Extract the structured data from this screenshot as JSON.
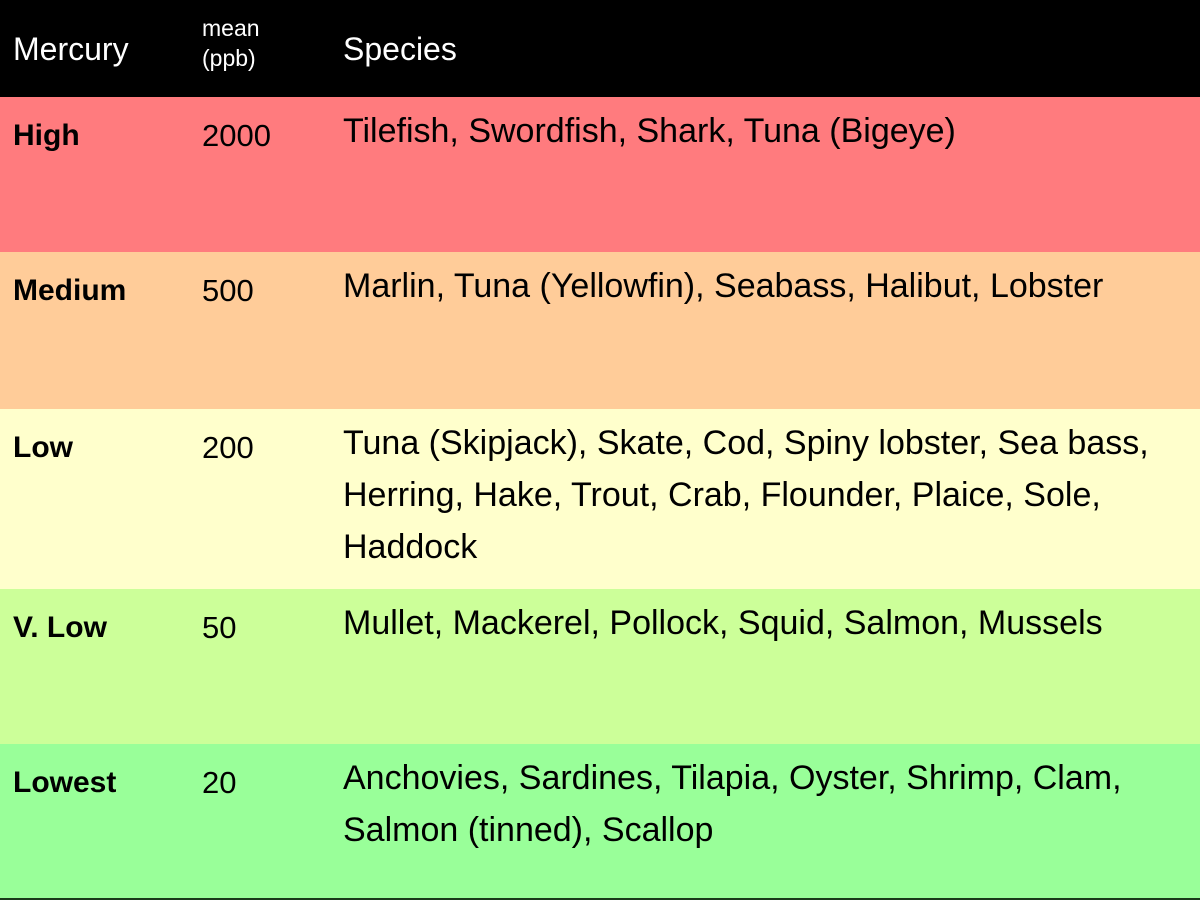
{
  "header": {
    "mercury": "Mercury",
    "mean_line1": "mean",
    "mean_line2": "(ppb)",
    "species": "Species"
  },
  "rows": [
    {
      "level": "High",
      "mean_ppb": "2000",
      "species": "Tilefish, Swordfish, Shark, Tuna (Bigeye)",
      "color": "#ff7b7e"
    },
    {
      "level": "Medium",
      "mean_ppb": "500",
      "species": "Marlin, Tuna (Yellowfin), Seabass, Halibut, Lobster",
      "color": "#ffcc99"
    },
    {
      "level": "Low",
      "mean_ppb": "200",
      "species": "Tuna (Skipjack), Skate, Cod, Spiny lobster, Sea bass, Herring, Hake, Trout, Crab, Flounder, Plaice, Sole, Haddock",
      "color": "#ffffcc"
    },
    {
      "level": "V. Low",
      "mean_ppb": "50",
      "species": "Mullet, Mackerel, Pollock, Squid, Salmon, Mussels",
      "color": "#ccff99"
    },
    {
      "level": "Lowest",
      "mean_ppb": "20",
      "species": "Anchovies, Sardines, Tilapia, Oyster, Shrimp, Clam, Salmon (tinned), Scallop",
      "color": "#99ff99"
    }
  ]
}
